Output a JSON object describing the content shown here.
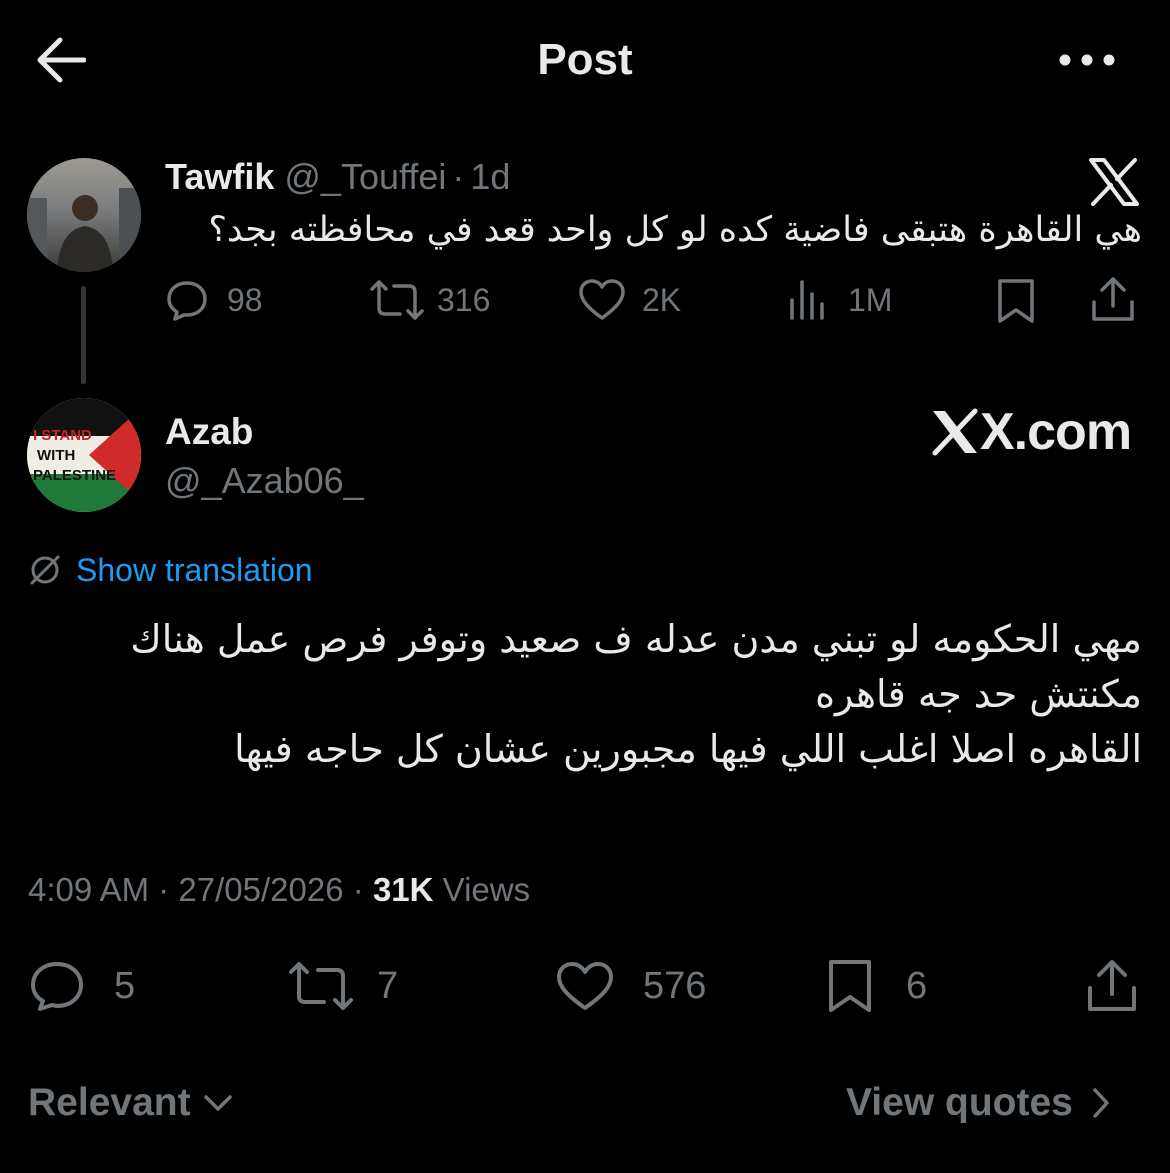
{
  "header": {
    "title": "Post"
  },
  "quoted_post": {
    "author_name": "Tawfik",
    "handle": "@_Touffei",
    "separator": "·",
    "time": "1d",
    "text": "هي القاهرة هتبقى فاضية كده لو كل واحد قعد في محافظته بجد؟",
    "metrics": {
      "replies": "98",
      "reposts": "316",
      "likes": "2K",
      "views": "1M"
    }
  },
  "main_post": {
    "author_name": "Azab",
    "handle": "@_Azab06_",
    "avatar_text": [
      "I STAND",
      "WITH",
      "PALESTINE"
    ],
    "translate_label": "Show translation",
    "text_lines": [
      "مهي الحكومه لو تبني مدن عدله ف صعيد وتوفر فرص عمل هناك",
      "مكنتش حد جه قاهره",
      "القاهره اصلا اغلب اللي فيها مجبورين عشان كل حاجه فيها"
    ],
    "time": "4:09 AM",
    "date": "27/05/2026",
    "dot": "·",
    "views_count": "31K",
    "views_label": "Views",
    "metrics": {
      "replies": "5",
      "reposts": "7",
      "likes": "576",
      "bookmarks": "6"
    }
  },
  "watermark": {
    "text": "X.com"
  },
  "footer": {
    "sort_label": "Relevant",
    "quotes_label": "View quotes"
  },
  "colors": {
    "background": "#000000",
    "text": "#e7e9ea",
    "secondary": "#71767b",
    "link": "#1d9bf0"
  }
}
